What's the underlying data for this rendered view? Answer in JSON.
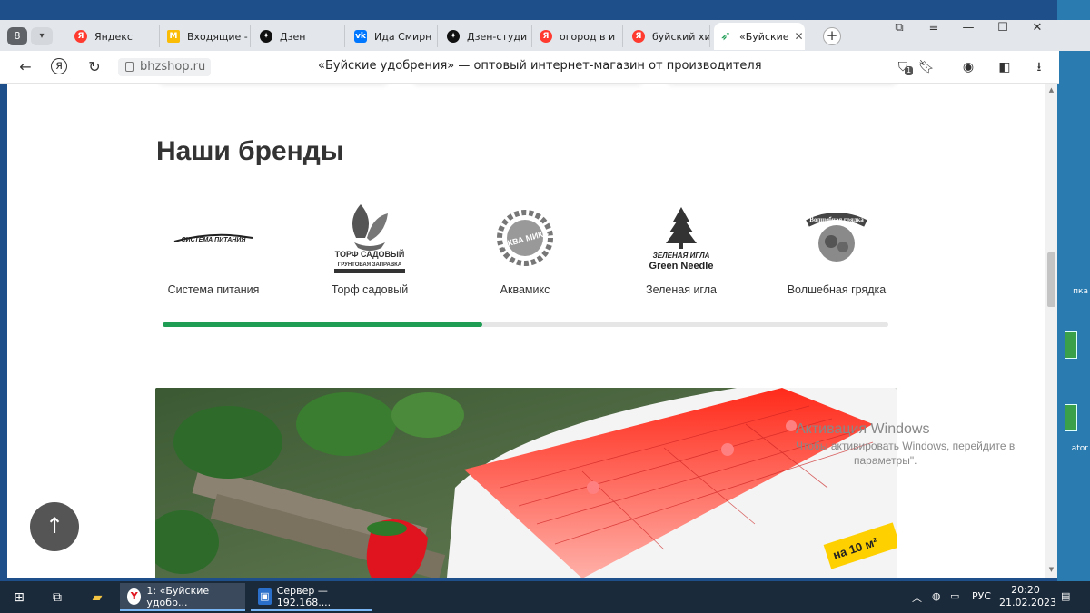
{
  "tabs": {
    "count": "8",
    "items": [
      {
        "label": "Яндекс",
        "icon": "yandex-icon",
        "color": "#ff3b30"
      },
      {
        "label": "Входящие -",
        "icon": "gmail-icon",
        "color": "#ea4335"
      },
      {
        "label": "Дзен",
        "icon": "zen-icon",
        "color": "#111111"
      },
      {
        "label": "Ида Смирн",
        "icon": "vk-icon",
        "color": "#0077ff"
      },
      {
        "label": "Дзен-студи",
        "icon": "zen-icon",
        "color": "#111111"
      },
      {
        "label": "огород в и",
        "icon": "yandex-icon",
        "color": "#ff3b30"
      },
      {
        "label": "буйский хи",
        "icon": "yandex-icon",
        "color": "#ff3b30"
      },
      {
        "label": "«Буйские",
        "icon": "bhz-leaf-icon",
        "color": "#1f9d55"
      }
    ]
  },
  "address": {
    "domain": "bhzshop.ru",
    "page_title": "«Буйские удобрения» — оптовый интернет-магазин от производителя",
    "badge_count": "1"
  },
  "brands_section": {
    "title": "Наши бренды",
    "brands": [
      {
        "name": "Система питания",
        "logo_text": "СИСТЕМА ПИТАНИЯ"
      },
      {
        "name": "Торф садовый",
        "logo_text": "ТОРФ САДОВЫЙ",
        "logo_sub": "ГРУНТОВАЯ ЗАПРАВКА"
      },
      {
        "name": "Аквамикс",
        "logo_text": "АКВА МИКС"
      },
      {
        "name": "Зеленая игла",
        "logo_text": "ЗЕЛЁНАЯ ИГЛА",
        "logo_sub": "Green Needle"
      },
      {
        "name": "Волшебная грядка",
        "logo_text": "Волшебная грядка"
      }
    ],
    "carousel_progress": 0.44
  },
  "banner": {
    "label_text": "на 10 м²"
  },
  "activation": {
    "line1": "Активация Windows",
    "line2": "Чтобы активировать Windows, перейдите в",
    "line3": "параметры\"."
  },
  "taskbar": {
    "apps": [
      {
        "label": "1: «Буйские удобр...",
        "icon": "yandex-browser-icon"
      },
      {
        "label": "Сервер — 192.168....",
        "icon": "remote-desktop-icon"
      }
    ],
    "lang": "РУС",
    "time": "20:20",
    "date": "21.02.2023"
  },
  "desktop": {
    "labels": [
      "пка",
      "ator"
    ]
  },
  "colors": {
    "accent": "#1f9d55",
    "taskbar": "#1b2a3a"
  }
}
